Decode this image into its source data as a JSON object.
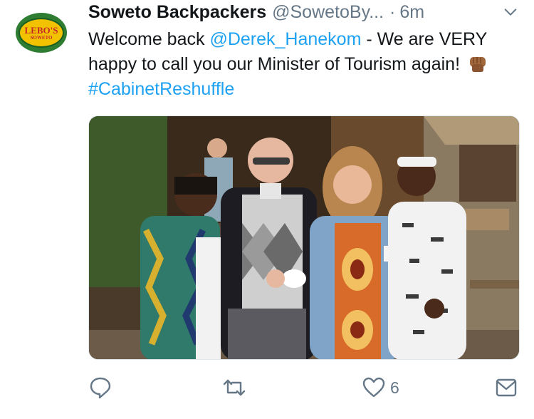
{
  "tweet": {
    "avatar_text_top": "LEBO'S",
    "avatar_text_bottom": "SOWETO",
    "display_name": "Soweto Backpackers",
    "handle": "@SowetoBy...",
    "separator": "·",
    "time": "6m",
    "text_part1": "Welcome back ",
    "mention": "@Derek_Hanekom",
    "text_part2": " - We are VERY happy to call you our Minister of Tourism again!",
    "hashtag": "#CabinetReshuffle",
    "emoji": "raised-fist-icon"
  },
  "actions": {
    "reply_icon": "reply-icon",
    "retweet_icon": "retweet-icon",
    "like_icon": "heart-icon",
    "like_count": "6",
    "share_icon": "share-icon"
  },
  "colors": {
    "link": "#1da1f2",
    "secondary_text": "#657786",
    "primary_text": "#14171a"
  }
}
